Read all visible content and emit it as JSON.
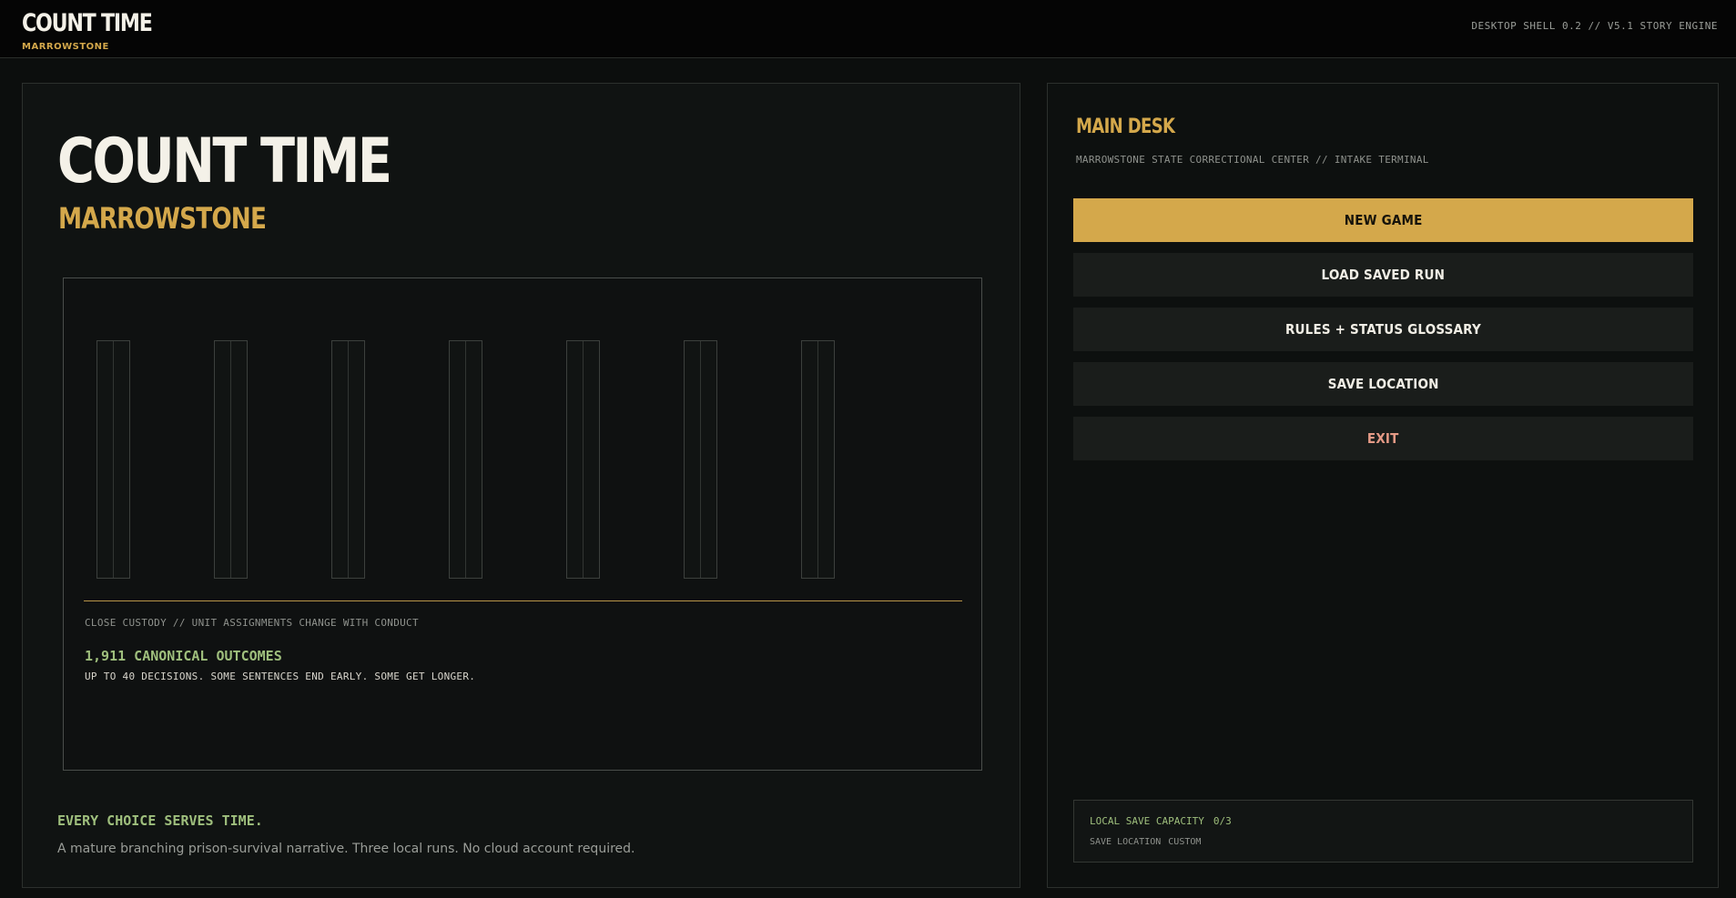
{
  "header": {
    "title": "COUNT TIME",
    "subtitle": "MARROWSTONE",
    "version": "DESKTOP SHELL 0.2 // V5.1 STORY ENGINE"
  },
  "hero": {
    "title": "COUNT TIME",
    "subtitle": "MARROWSTONE",
    "custody": "CLOSE CUSTODY // UNIT ASSIGNMENTS CHANGE WITH CONDUCT",
    "outcomes": "1,911 CANONICAL OUTCOMES",
    "decisions": "UP TO 40 DECISIONS. SOME SENTENCES END EARLY. SOME GET LONGER.",
    "tagline": "EVERY CHOICE SERVES TIME.",
    "description": "A mature branching prison-survival narrative. Three local runs. No cloud account required."
  },
  "desk": {
    "title": "MAIN DESK",
    "subtitle": "MARROWSTONE STATE CORRECTIONAL CENTER // INTAKE TERMINAL",
    "buttons": {
      "new_game": "NEW GAME",
      "load_saved_run": "LOAD SAVED RUN",
      "rules_glossary": "RULES + STATUS GLOSSARY",
      "save_location": "SAVE LOCATION",
      "exit": "EXIT"
    },
    "save_box": {
      "capacity_label": "LOCAL SAVE CAPACITY",
      "capacity_value": "0/3",
      "location_label": "SAVE LOCATION",
      "location_value": "CUSTOM"
    }
  },
  "colors": {
    "accent_gold": "#d4a84b",
    "accent_green": "#9fbf7d",
    "exit_red": "#e59a86",
    "background": "#0c0e0d"
  }
}
